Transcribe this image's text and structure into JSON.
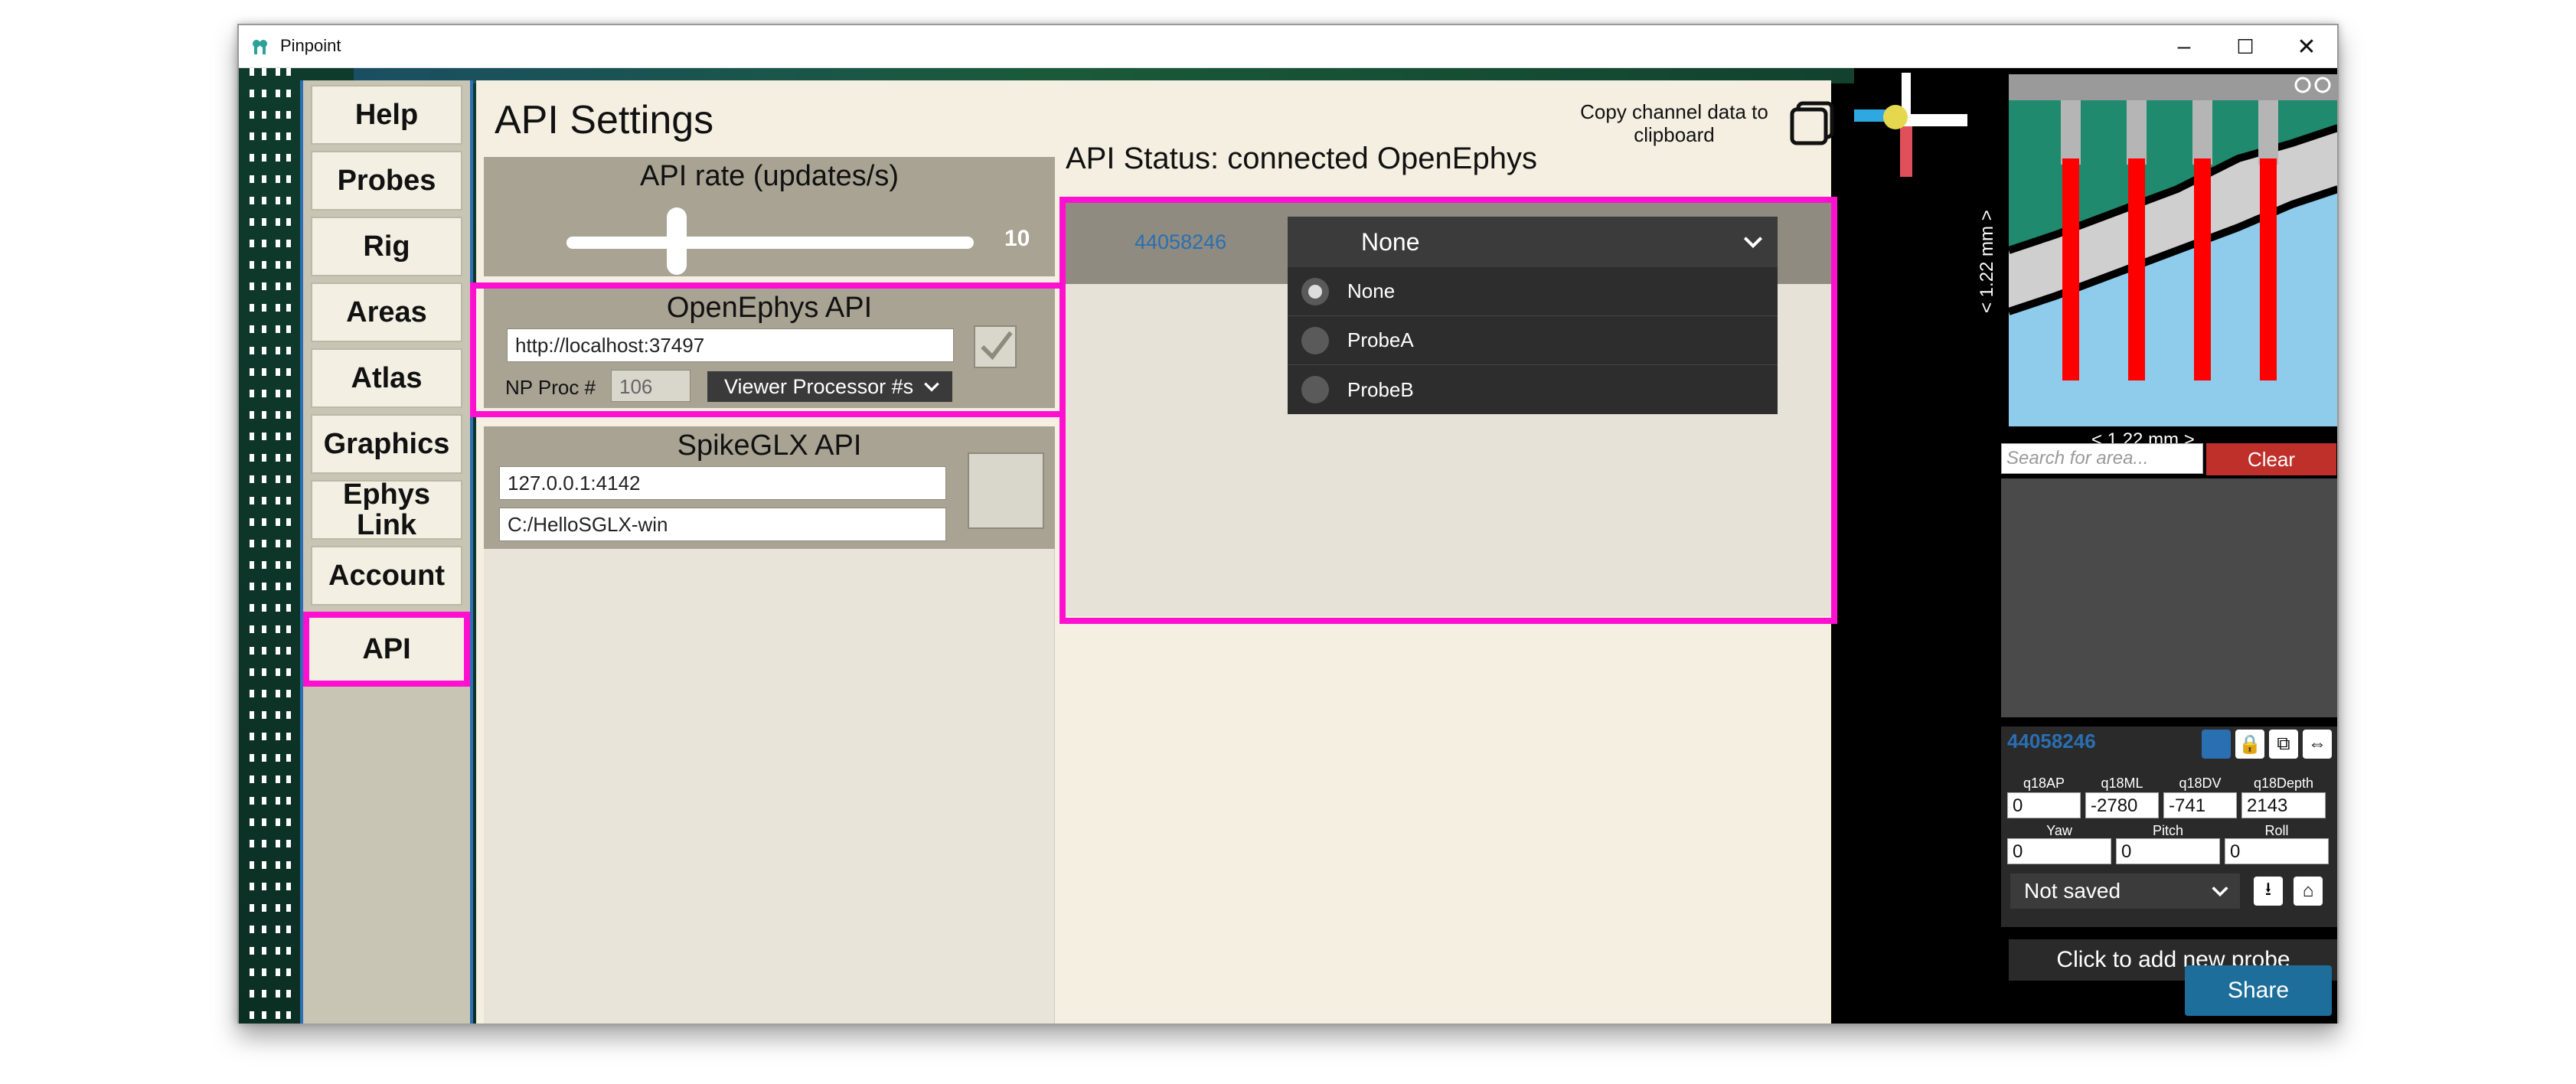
{
  "window": {
    "title": "Pinpoint",
    "minimize": "–",
    "maximize": "☐",
    "close": "✕"
  },
  "nav": {
    "items": [
      {
        "label": "Help"
      },
      {
        "label": "Probes"
      },
      {
        "label": "Rig"
      },
      {
        "label": "Areas"
      },
      {
        "label": "Atlas"
      },
      {
        "label": "Graphics"
      },
      {
        "label": "Ephys Link"
      },
      {
        "label": "Account"
      },
      {
        "label": "API",
        "active": true
      }
    ]
  },
  "settings": {
    "title": "API Settings",
    "copy_label": "Copy channel data to clipboard",
    "rate": {
      "title": "API rate (updates/s)",
      "value": "10",
      "fraction": 0.27
    },
    "openephys": {
      "title": "OpenEphys API",
      "url": "http://localhost:37497",
      "np_proc_label": "NP Proc #",
      "np_proc_value": "106",
      "viewer_label": "Viewer Processor #s"
    },
    "spikeglx": {
      "title": "SpikeGLX API",
      "host": "127.0.0.1:4142",
      "path": "C:/HelloSGLX-win"
    },
    "status": {
      "label": "API Status: connected OpenEphys",
      "probe_id": "44058246",
      "selected": "None",
      "options": [
        "None",
        "ProbeA",
        "ProbeB"
      ]
    }
  },
  "right": {
    "y_label": "< 1.22 mm >",
    "x_label": "< 1.22 mm >",
    "search_placeholder": "Search for area...",
    "clear_label": "Clear",
    "probe_id": "44058246",
    "fields": {
      "ap_label": "q18AP",
      "ap": "0",
      "ml_label": "q18ML",
      "ml": "-2780",
      "dv_label": "q18DV",
      "dv": "-741",
      "depth_label": "q18Depth",
      "depth": "2143",
      "yaw_label": "Yaw",
      "yaw": "0",
      "pitch_label": "Pitch",
      "pitch": "0",
      "roll_label": "Roll",
      "roll": "0"
    },
    "saved_label": "Not saved",
    "add_probe_label": "Click to add new probe",
    "share_label": "Share"
  },
  "colors": {
    "highlight": "#ff10d0",
    "link_blue": "#2a6fb1",
    "probe_red": "#ff0000",
    "clear_red": "#c0302b",
    "share_blue": "#1d6e9a"
  },
  "icons": [
    "pinpoint-logo-icon",
    "copy-icon",
    "checkmark-icon",
    "chevron-down-icon",
    "lock-icon",
    "duplicate-icon",
    "swap-icon",
    "download-icon",
    "home-icon",
    "zoom-out-icon",
    "zoom-in-icon"
  ]
}
